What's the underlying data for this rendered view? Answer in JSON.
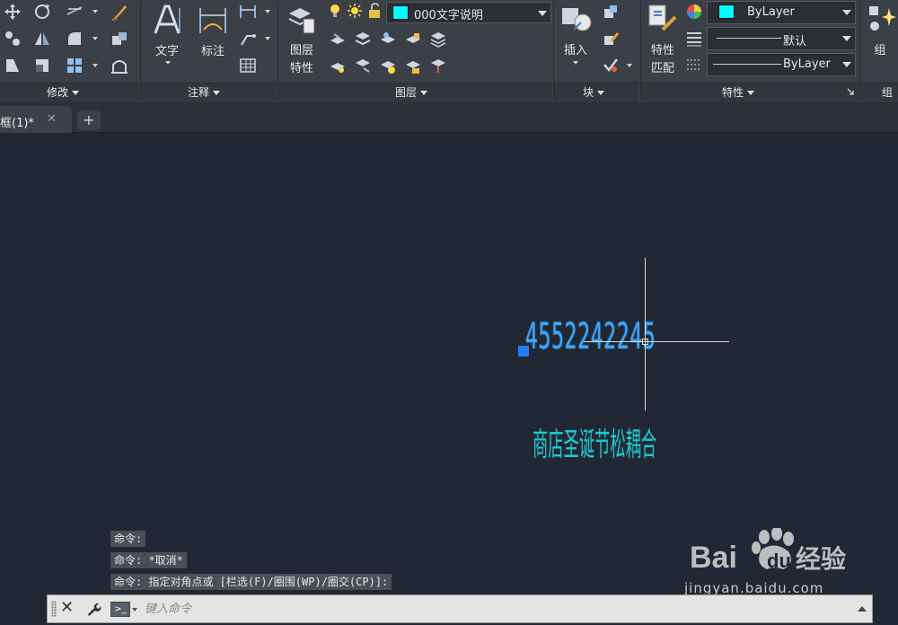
{
  "ribbon": {
    "panels": {
      "modify": "修改",
      "annotation": "注释",
      "layers": "图层",
      "block": "块",
      "properties": "特性",
      "groups": "组"
    },
    "buttons": {
      "text": "文字",
      "dimension": "标注",
      "layer_properties_line1": "图层",
      "layer_properties_line2": "特性",
      "insert": "插入",
      "match_properties_line1": "特性",
      "match_properties_line2": "匹配",
      "group": "组"
    },
    "layer_combo": {
      "value": "000文字说明",
      "color": "#00ffff"
    },
    "color_combo": {
      "value": "ByLayer",
      "color": "#00ffff"
    },
    "linetype_combo": {
      "value": "默认"
    },
    "lineweight_combo": {
      "value": "ByLayer"
    }
  },
  "tabs": [
    {
      "label": "框(1)*"
    }
  ],
  "tab_add_label": "+",
  "drawing": {
    "number_text": "4552242245",
    "chinese_text": "商店圣诞节松耦合",
    "number_text_color": "#3aa7ff",
    "chinese_text_color": "#19c9d3"
  },
  "command_history": [
    "命令:",
    "命令: *取消*",
    "命令: 指定对角点或 [栏选(F)/圈围(WP)/圈交(CP)]:"
  ],
  "command_line": {
    "placeholder": "键入命令",
    "close_label": "✕"
  },
  "watermark": {
    "brand": "Bai du 经验",
    "url": "jingyan.baidu.com"
  }
}
